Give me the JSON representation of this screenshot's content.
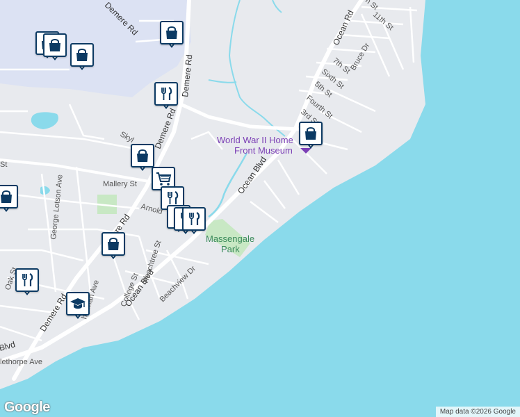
{
  "map": {
    "water_color": "#8adaeb",
    "land_color": "#e8eaee",
    "road_color": "#ffffff",
    "park_color": "#c8e8c4",
    "poi_label_color": "#7b3fb5",
    "park_label_color": "#3a8a5a",
    "marker_color": "#0c3a63"
  },
  "roads": {
    "demere_rd_top": "Demere Rd",
    "demere_rd_mid": "Demere Rd",
    "demere_rd_lower": "Demere Rd",
    "demere_rd_bottom": "Demere Rd",
    "ocean_rd": "Ocean Rd",
    "ocean_blvd_upper": "Ocean Blvd",
    "ocean_blvd_lower": "Ocean Blvd",
    "ocean_blvd_left": "Blvd",
    "skylane": "Skyl",
    "mallery_st": "Mallery St",
    "arnold": "Arnold",
    "george_lotson": "George Lotson Ave",
    "peachtree": "Peachtree St",
    "college": "College St",
    "beachview": "Beachview Dr",
    "sherman": "herman Ave",
    "oak": "Oak St",
    "oglethorpe": "lethorpe Ave",
    "st_left": "St",
    "street_11th": "11th St",
    "street_12th": "h St",
    "bruce_dr": "Bruce Dr",
    "street_7th": "7th St",
    "sixth": "Sixth St",
    "street_5th": "5th St",
    "fourth": "Fourth St",
    "street_3rd": "3rd St"
  },
  "places": {
    "museum_line1": "World War II Home",
    "museum_line2": "Front Museum",
    "park_line1": "Massengale",
    "park_line2": "Park"
  },
  "markers": [
    {
      "type": "shopping",
      "icon": "shopping-bag-icon"
    },
    {
      "type": "shopping",
      "icon": "shopping-bag-icon"
    },
    {
      "type": "shopping",
      "icon": "shopping-bag-icon"
    },
    {
      "type": "shopping",
      "icon": "shopping-bag-icon"
    },
    {
      "type": "restaurant",
      "icon": "fork-knife-icon"
    },
    {
      "type": "shopping",
      "icon": "shopping-bag-icon"
    },
    {
      "type": "grocery",
      "icon": "shopping-cart-icon"
    },
    {
      "type": "shopping",
      "icon": "shopping-bag-icon"
    },
    {
      "type": "restaurant",
      "icon": "fork-knife-icon"
    },
    {
      "type": "restaurant",
      "icon": "fork-knife-icon"
    },
    {
      "type": "restaurant",
      "icon": "fork-knife-icon"
    },
    {
      "type": "restaurant",
      "icon": "fork-knife-icon"
    },
    {
      "type": "shopping",
      "icon": "shopping-bag-icon"
    },
    {
      "type": "restaurant",
      "icon": "fork-knife-icon"
    },
    {
      "type": "school",
      "icon": "graduation-cap-icon"
    },
    {
      "type": "shopping",
      "icon": "shopping-bag-icon"
    }
  ],
  "footer": {
    "logo": "Google",
    "attribution": "Map data ©2026 Google"
  }
}
